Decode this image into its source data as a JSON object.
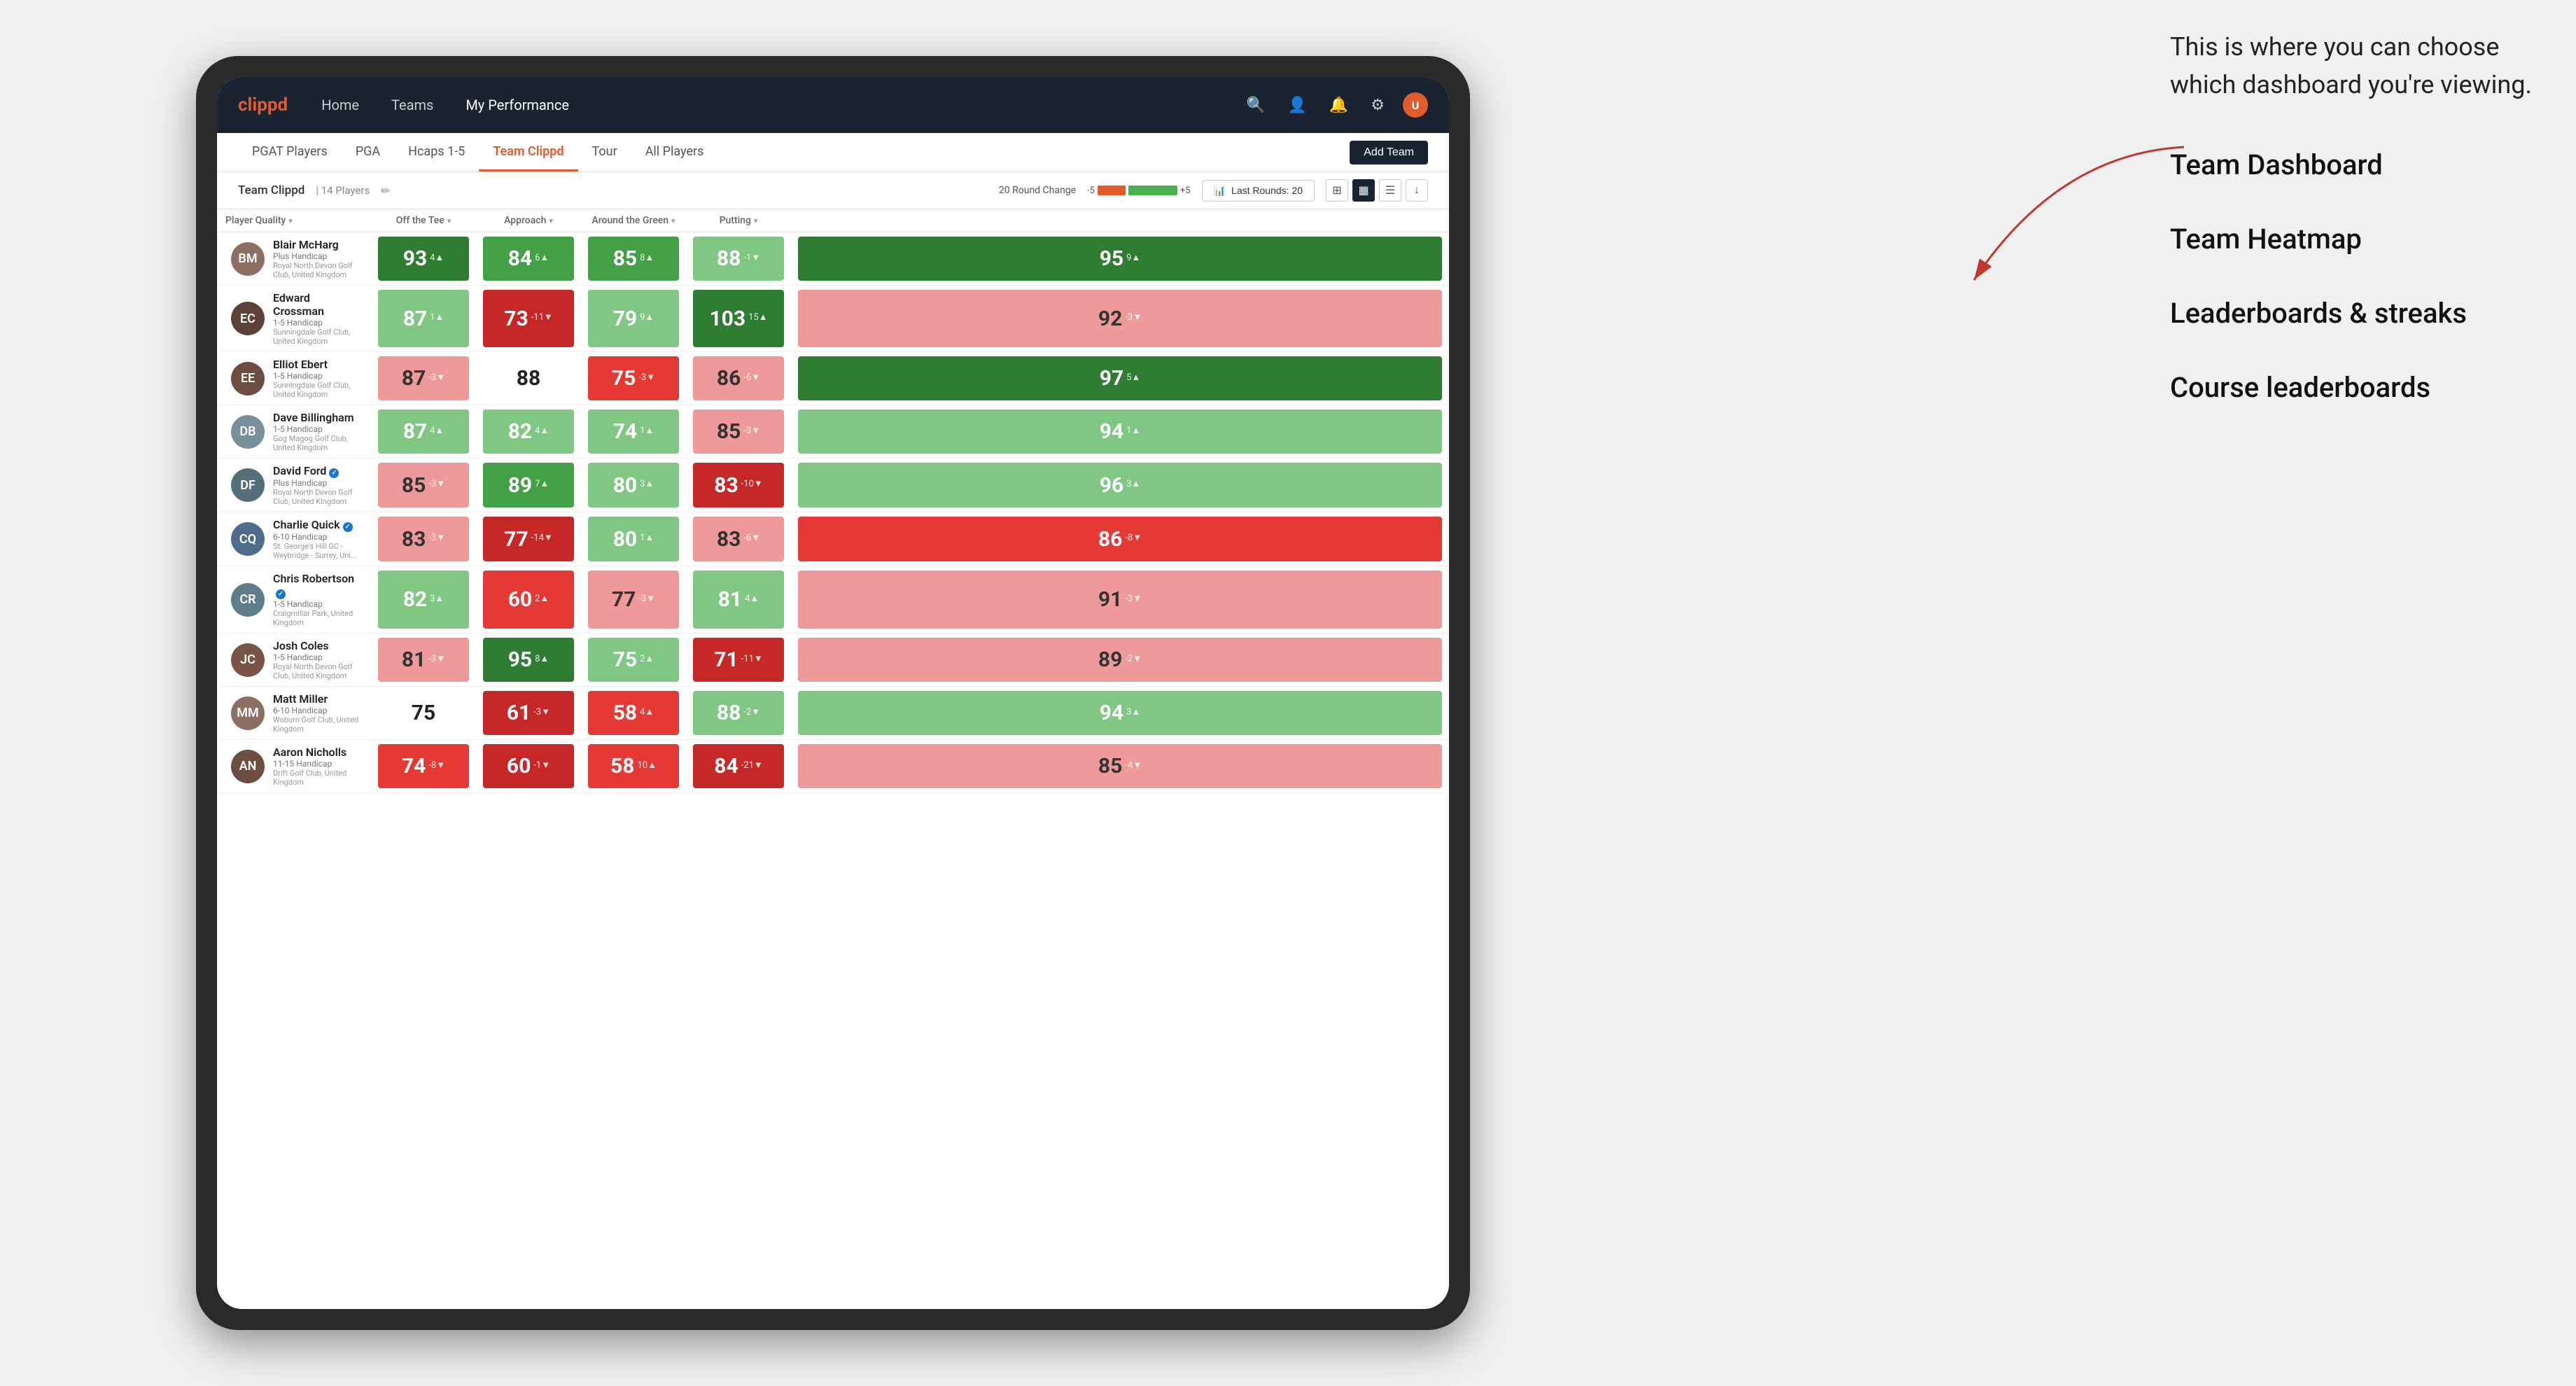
{
  "annotation": {
    "description": "This is where you can choose which dashboard you're viewing.",
    "options": [
      "Team Dashboard",
      "Team Heatmap",
      "Leaderboards & streaks",
      "Course leaderboards"
    ]
  },
  "nav": {
    "logo": "clippd",
    "links": [
      "Home",
      "Teams",
      "My Performance"
    ],
    "active_link": "My Performance"
  },
  "sub_nav": {
    "tabs": [
      "PGAT Players",
      "PGA",
      "Hcaps 1-5",
      "Team Clippd",
      "Tour",
      "All Players"
    ],
    "active_tab": "Team Clippd",
    "add_team_label": "Add Team"
  },
  "team_header": {
    "team_name": "Team Clippd",
    "separator": "|",
    "player_count": "14 Players",
    "round_change_label": "20 Round Change",
    "round_change_neg": "-5",
    "round_change_pos": "+5",
    "last_rounds_label": "Last Rounds:",
    "last_rounds_value": "20"
  },
  "table": {
    "columns": {
      "player": "Player Quality",
      "off_tee": "Off the Tee",
      "approach": "Approach",
      "around_green": "Around the Green",
      "putting": "Putting"
    },
    "players": [
      {
        "name": "Blair McHarg",
        "handicap": "Plus Handicap",
        "club": "Royal North Devon Golf Club, United Kingdom",
        "avatar_color": "#8d6e63",
        "initials": "BM",
        "player_quality": {
          "value": 93,
          "change": "4▲",
          "color": "green-dark"
        },
        "off_tee": {
          "value": 84,
          "change": "6▲",
          "color": "green-med"
        },
        "approach": {
          "value": 85,
          "change": "8▲",
          "color": "green-med"
        },
        "around_green": {
          "value": 88,
          "change": "-1▼",
          "color": "green-light"
        },
        "putting": {
          "value": 95,
          "change": "9▲",
          "color": "green-dark"
        }
      },
      {
        "name": "Edward Crossman",
        "handicap": "1-5 Handicap",
        "club": "Sunningdale Golf Club, United Kingdom",
        "avatar_color": "#5d4037",
        "initials": "EC",
        "player_quality": {
          "value": 87,
          "change": "1▲",
          "color": "green-light"
        },
        "off_tee": {
          "value": 73,
          "change": "-11▼",
          "color": "red-dark"
        },
        "approach": {
          "value": 79,
          "change": "9▲",
          "color": "green-light"
        },
        "around_green": {
          "value": 103,
          "change": "15▲",
          "color": "green-dark"
        },
        "putting": {
          "value": 92,
          "change": "-3▼",
          "color": "red-light"
        }
      },
      {
        "name": "Elliot Ebert",
        "handicap": "1-5 Handicap",
        "club": "Sunningdale Golf Club, United Kingdom",
        "avatar_color": "#6d4c41",
        "initials": "EE",
        "player_quality": {
          "value": 87,
          "change": "-3▼",
          "color": "red-light"
        },
        "off_tee": {
          "value": 88,
          "change": "",
          "color": "white-cell"
        },
        "approach": {
          "value": 75,
          "change": "-3▼",
          "color": "red-med"
        },
        "around_green": {
          "value": 86,
          "change": "-6▼",
          "color": "red-light"
        },
        "putting": {
          "value": 97,
          "change": "5▲",
          "color": "green-dark"
        }
      },
      {
        "name": "Dave Billingham",
        "handicap": "1-5 Handicap",
        "club": "Gog Magog Golf Club, United Kingdom",
        "avatar_color": "#78909c",
        "initials": "DB",
        "player_quality": {
          "value": 87,
          "change": "4▲",
          "color": "green-light"
        },
        "off_tee": {
          "value": 82,
          "change": "4▲",
          "color": "green-light"
        },
        "approach": {
          "value": 74,
          "change": "1▲",
          "color": "green-light"
        },
        "around_green": {
          "value": 85,
          "change": "-3▼",
          "color": "red-light"
        },
        "putting": {
          "value": 94,
          "change": "1▲",
          "color": "green-light"
        }
      },
      {
        "name": "David Ford",
        "handicap": "Plus Handicap",
        "club": "Royal North Devon Golf Club, United Kingdom",
        "avatar_color": "#546e7a",
        "initials": "DF",
        "verified": true,
        "player_quality": {
          "value": 85,
          "change": "-3▼",
          "color": "red-light"
        },
        "off_tee": {
          "value": 89,
          "change": "7▲",
          "color": "green-med"
        },
        "approach": {
          "value": 80,
          "change": "3▲",
          "color": "green-light"
        },
        "around_green": {
          "value": 83,
          "change": "-10▼",
          "color": "red-dark"
        },
        "putting": {
          "value": 96,
          "change": "3▲",
          "color": "green-light"
        }
      },
      {
        "name": "Charlie Quick",
        "handicap": "6-10 Handicap",
        "club": "St. George's Hill GC - Weybridge - Surrey, Uni...",
        "avatar_color": "#4e6b8c",
        "initials": "CQ",
        "verified": true,
        "player_quality": {
          "value": 83,
          "change": "-3▼",
          "color": "red-light"
        },
        "off_tee": {
          "value": 77,
          "change": "-14▼",
          "color": "red-dark"
        },
        "approach": {
          "value": 80,
          "change": "1▲",
          "color": "green-light"
        },
        "around_green": {
          "value": 83,
          "change": "-6▼",
          "color": "red-light"
        },
        "putting": {
          "value": 86,
          "change": "-8▼",
          "color": "red-med"
        }
      },
      {
        "name": "Chris Robertson",
        "handicap": "1-5 Handicap",
        "club": "Craigmillar Park, United Kingdom",
        "avatar_color": "#607d8b",
        "initials": "CR",
        "verified": true,
        "player_quality": {
          "value": 82,
          "change": "3▲",
          "color": "green-light"
        },
        "off_tee": {
          "value": 60,
          "change": "2▲",
          "color": "red-med"
        },
        "approach": {
          "value": 77,
          "change": "-3▼",
          "color": "red-light"
        },
        "around_green": {
          "value": 81,
          "change": "4▲",
          "color": "green-light"
        },
        "putting": {
          "value": 91,
          "change": "-3▼",
          "color": "red-light"
        }
      },
      {
        "name": "Josh Coles",
        "handicap": "1-5 Handicap",
        "club": "Royal North Devon Golf Club, United Kingdom",
        "avatar_color": "#795548",
        "initials": "JC",
        "player_quality": {
          "value": 81,
          "change": "-3▼",
          "color": "red-light"
        },
        "off_tee": {
          "value": 95,
          "change": "8▲",
          "color": "green-dark"
        },
        "approach": {
          "value": 75,
          "change": "2▲",
          "color": "green-light"
        },
        "around_green": {
          "value": 71,
          "change": "-11▼",
          "color": "red-dark"
        },
        "putting": {
          "value": 89,
          "change": "-2▼",
          "color": "red-light"
        }
      },
      {
        "name": "Matt Miller",
        "handicap": "6-10 Handicap",
        "club": "Woburn Golf Club, United Kingdom",
        "avatar_color": "#8d6e63",
        "initials": "MM",
        "player_quality": {
          "value": 75,
          "change": "",
          "color": "white-cell"
        },
        "off_tee": {
          "value": 61,
          "change": "-3▼",
          "color": "red-dark"
        },
        "approach": {
          "value": 58,
          "change": "4▲",
          "color": "red-med"
        },
        "around_green": {
          "value": 88,
          "change": "-2▼",
          "color": "green-light"
        },
        "putting": {
          "value": 94,
          "change": "3▲",
          "color": "green-light"
        }
      },
      {
        "name": "Aaron Nicholls",
        "handicap": "11-15 Handicap",
        "club": "Drift Golf Club, United Kingdom",
        "avatar_color": "#6d4c41",
        "initials": "AN",
        "player_quality": {
          "value": 74,
          "change": "-8▼",
          "color": "red-med"
        },
        "off_tee": {
          "value": 60,
          "change": "-1▼",
          "color": "red-dark"
        },
        "approach": {
          "value": 58,
          "change": "10▲",
          "color": "red-med"
        },
        "around_green": {
          "value": 84,
          "change": "-21▼",
          "color": "red-dark"
        },
        "putting": {
          "value": 85,
          "change": "-4▼",
          "color": "red-light"
        }
      }
    ]
  }
}
